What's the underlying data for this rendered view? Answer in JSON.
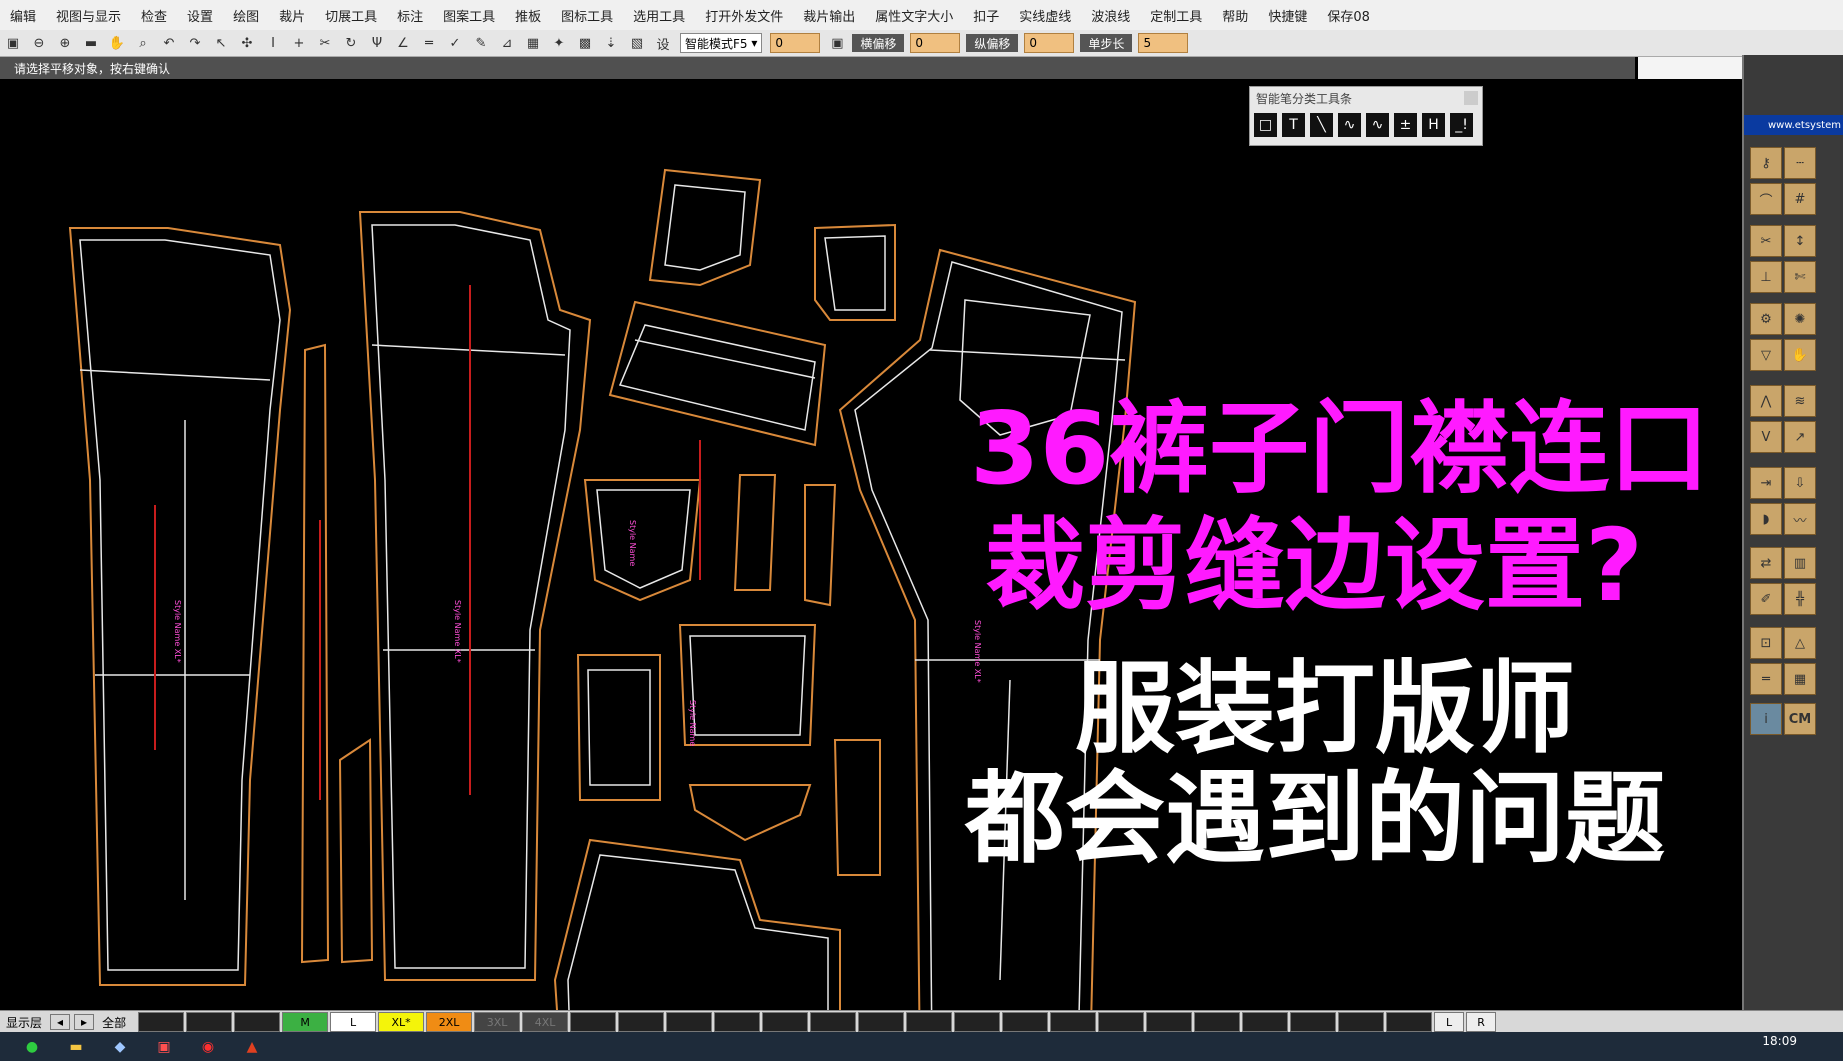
{
  "menu": [
    "编辑",
    "视图与显示",
    "检查",
    "设置",
    "绘图",
    "裁片",
    "切展工具",
    "标注",
    "图案工具",
    "推板",
    "图标工具",
    "选用工具",
    "打开外发文件",
    "裁片输出",
    "属性文字大小",
    "扣子",
    "实线虚线",
    "波浪线",
    "定制工具",
    "帮助",
    "快捷键",
    "保存08"
  ],
  "toolbar": {
    "mode_select": "智能模式F5",
    "offset_value": "0",
    "h_offset_label": "横偏移",
    "h_offset_value": "0",
    "v_offset_label": "纵偏移",
    "v_offset_value": "0",
    "step_label": "单步长",
    "step_value": "5",
    "set_label": "设"
  },
  "status": {
    "prompt": "请选择平移对象，按右键确认"
  },
  "smart_toolbar": {
    "title": "智能笔分类工具条",
    "icons": [
      "□",
      "T",
      "╲",
      "∿",
      "∿",
      "±",
      "H",
      "_!"
    ]
  },
  "right_panel": {
    "logo": "www.etsystem",
    "cm_label": "CM"
  },
  "overlay": {
    "line1": "36裤子门襟连口",
    "line2": "裁剪缝边设置?",
    "line3": "服装打版师",
    "line4": "都会遇到的问题"
  },
  "size_bar": {
    "layer_label": "显示层",
    "all_label": "全部",
    "sizes": [
      "M",
      "L",
      "XL*",
      "2XL",
      "3XL",
      "4XL"
    ],
    "lr": [
      "L",
      "R"
    ]
  },
  "taskbar": {
    "time": "18:09"
  },
  "colors": {
    "overlay_magenta": "#ff1aff",
    "overlay_white": "#ffffff",
    "pattern_orange": "#d9893a",
    "pattern_white": "#e8e8e8"
  }
}
